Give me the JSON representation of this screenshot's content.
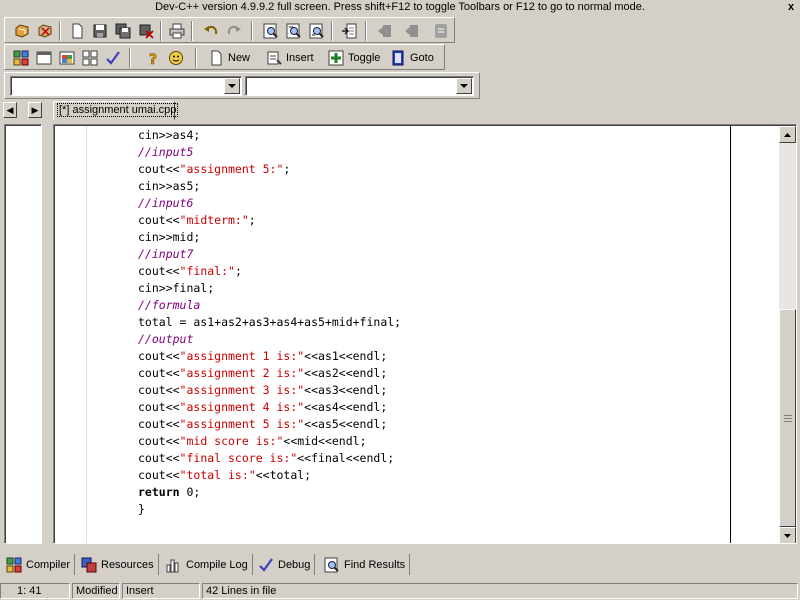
{
  "window": {
    "title": "Dev-C++ version 4.9.9.2 full screen. Press shift+F12 to toggle Toolbars or F12 to go to normal mode.",
    "close_glyph": "x"
  },
  "toolbar": {
    "new_label": "New",
    "insert_label": "Insert",
    "toggle_label": "Toggle",
    "goto_label": "Goto"
  },
  "combos": {
    "class_value": "",
    "member_value": ""
  },
  "nav": {
    "left_glyph": "◀",
    "right_glyph": "▶"
  },
  "editor": {
    "tab_label": "[*] assignment umai.cpp",
    "lines": [
      [
        {
          "t": "cin>>as4;",
          "c": ""
        }
      ],
      [
        {
          "t": "//input5",
          "c": "cmt"
        }
      ],
      [
        {
          "t": "cout<<",
          "c": ""
        },
        {
          "t": "\"assignment 5:\"",
          "c": "str"
        },
        {
          "t": ";",
          "c": ""
        }
      ],
      [
        {
          "t": "cin>>as5;",
          "c": ""
        }
      ],
      [
        {
          "t": "//input6",
          "c": "cmt"
        }
      ],
      [
        {
          "t": "cout<<",
          "c": ""
        },
        {
          "t": "\"midterm:\"",
          "c": "str"
        },
        {
          "t": ";",
          "c": ""
        }
      ],
      [
        {
          "t": "cin>>mid;",
          "c": ""
        }
      ],
      [
        {
          "t": "//input7",
          "c": "cmt"
        }
      ],
      [
        {
          "t": "cout<<",
          "c": ""
        },
        {
          "t": "\"final:\"",
          "c": "str"
        },
        {
          "t": ";",
          "c": ""
        }
      ],
      [
        {
          "t": "cin>>final;",
          "c": ""
        }
      ],
      [
        {
          "t": "//formula",
          "c": "cmt"
        }
      ],
      [
        {
          "t": "total = as1+as2+as3+as4+as5+mid+final;",
          "c": ""
        }
      ],
      [
        {
          "t": "//output",
          "c": "cmt"
        }
      ],
      [
        {
          "t": "cout<<",
          "c": ""
        },
        {
          "t": "\"assignment 1 is:\"",
          "c": "str"
        },
        {
          "t": "<<as1<<endl;",
          "c": ""
        }
      ],
      [
        {
          "t": "cout<<",
          "c": ""
        },
        {
          "t": "\"assignment 2 is:\"",
          "c": "str"
        },
        {
          "t": "<<as2<<endl;",
          "c": ""
        }
      ],
      [
        {
          "t": "cout<<",
          "c": ""
        },
        {
          "t": "\"assignment 3 is:\"",
          "c": "str"
        },
        {
          "t": "<<as3<<endl;",
          "c": ""
        }
      ],
      [
        {
          "t": "cout<<",
          "c": ""
        },
        {
          "t": "\"assignment 4 is:\"",
          "c": "str"
        },
        {
          "t": "<<as4<<endl;",
          "c": ""
        }
      ],
      [
        {
          "t": "cout<<",
          "c": ""
        },
        {
          "t": "\"assignment 5 is:\"",
          "c": "str"
        },
        {
          "t": "<<as5<<endl;",
          "c": ""
        }
      ],
      [
        {
          "t": "cout<<",
          "c": ""
        },
        {
          "t": "\"mid score is:\"",
          "c": "str"
        },
        {
          "t": "<<mid<<endl;",
          "c": ""
        }
      ],
      [
        {
          "t": "cout<<",
          "c": ""
        },
        {
          "t": "\"final score is:\"",
          "c": "str"
        },
        {
          "t": "<<final<<endl;",
          "c": ""
        }
      ],
      [
        {
          "t": "cout<<",
          "c": ""
        },
        {
          "t": "\"total is:\"",
          "c": "str"
        },
        {
          "t": "<<total;",
          "c": ""
        }
      ],
      [
        {
          "t": "return",
          "c": "kw"
        },
        {
          "t": " 0;",
          "c": ""
        }
      ],
      [
        {
          "t": "}",
          "c": ""
        }
      ]
    ]
  },
  "bottom_tabs": {
    "compiler": "Compiler",
    "resources": "Resources",
    "compile_log": "Compile Log",
    "debug": "Debug",
    "find_results": "Find Results"
  },
  "status": {
    "position": "1: 41",
    "modified": "Modified",
    "mode": "Insert",
    "line_count": "42 Lines in file"
  },
  "colors": {
    "window_bg": "#d4d0c8",
    "comment": "#800080",
    "string": "#cc0000"
  }
}
